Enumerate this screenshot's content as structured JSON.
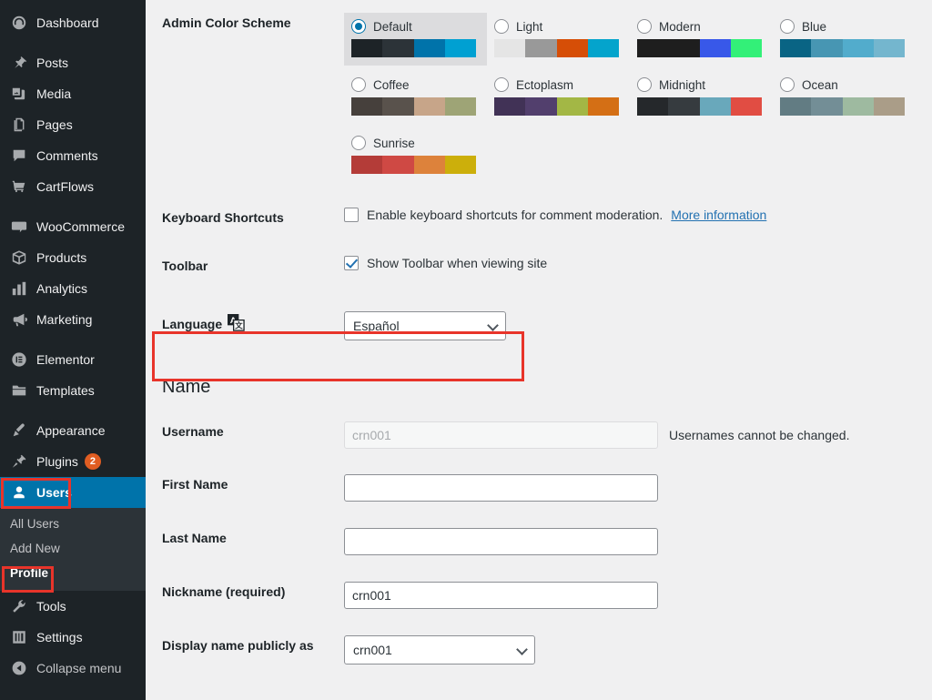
{
  "sidebar": {
    "items": [
      {
        "label": "Dashboard",
        "icon": "dashboard-icon",
        "name": "dashboard"
      },
      {
        "label": "Posts",
        "icon": "pin-icon",
        "name": "posts"
      },
      {
        "label": "Media",
        "icon": "media-icon",
        "name": "media"
      },
      {
        "label": "Pages",
        "icon": "pages-icon",
        "name": "pages"
      },
      {
        "label": "Comments",
        "icon": "comment-icon",
        "name": "comments"
      },
      {
        "label": "CartFlows",
        "icon": "cart-icon",
        "name": "cartflows"
      },
      {
        "label": "WooCommerce",
        "icon": "woo-icon",
        "name": "woocommerce"
      },
      {
        "label": "Products",
        "icon": "box-icon",
        "name": "products"
      },
      {
        "label": "Analytics",
        "icon": "chart-bar-icon",
        "name": "analytics"
      },
      {
        "label": "Marketing",
        "icon": "megaphone-icon",
        "name": "marketing"
      },
      {
        "label": "Elementor",
        "icon": "elementor-icon",
        "name": "elementor"
      },
      {
        "label": "Templates",
        "icon": "folder-icon",
        "name": "templates"
      },
      {
        "label": "Appearance",
        "icon": "brush-icon",
        "name": "appearance"
      },
      {
        "label": "Plugins",
        "icon": "plug-icon",
        "name": "plugins",
        "badge": "2"
      },
      {
        "label": "Users",
        "icon": "user-icon",
        "name": "users",
        "current": true
      },
      {
        "label": "Tools",
        "icon": "wrench-icon",
        "name": "tools"
      },
      {
        "label": "Settings",
        "icon": "settings-icon",
        "name": "settings"
      },
      {
        "label": "Collapse menu",
        "icon": "collapse-icon",
        "name": "collapse-menu"
      }
    ],
    "submenu": [
      {
        "label": "All Users",
        "name": "all-users"
      },
      {
        "label": "Add New",
        "name": "add-new"
      },
      {
        "label": "Profile",
        "name": "profile",
        "current": true
      }
    ],
    "colors": {
      "background": "#1d2327",
      "submenu_background": "#2c3338",
      "current_background": "#0073aa",
      "badge": "#e05d22"
    }
  },
  "main": {
    "color_scheme": {
      "label": "Admin Color Scheme",
      "selected": "Default",
      "options": [
        {
          "name": "Default",
          "selected": true,
          "swatch": [
            "#1d2327",
            "#2c3338",
            "#0073aa",
            "#00a0d2"
          ]
        },
        {
          "name": "Light",
          "selected": false,
          "swatch": [
            "#e5e5e5",
            "#999999",
            "#d64e07",
            "#04a4cc"
          ]
        },
        {
          "name": "Modern",
          "selected": false,
          "swatch": [
            "#1e1e1e",
            "#1e1e1e",
            "#3858e9",
            "#33f078"
          ]
        },
        {
          "name": "Blue",
          "selected": false,
          "swatch": [
            "#096484",
            "#4796b3",
            "#52accc",
            "#74b6ce"
          ]
        },
        {
          "name": "Coffee",
          "selected": false,
          "swatch": [
            "#46403c",
            "#59524c",
            "#c7a589",
            "#9ea476"
          ]
        },
        {
          "name": "Ectoplasm",
          "selected": false,
          "swatch": [
            "#413256",
            "#523f6d",
            "#a3b745",
            "#d46f15"
          ]
        },
        {
          "name": "Midnight",
          "selected": false,
          "swatch": [
            "#25282b",
            "#363b3f",
            "#69a8bb",
            "#e14d43"
          ]
        },
        {
          "name": "Ocean",
          "selected": false,
          "swatch": [
            "#627c83",
            "#738e96",
            "#9ebaa0",
            "#aa9d88"
          ]
        },
        {
          "name": "Sunrise",
          "selected": false,
          "swatch": [
            "#b43c38",
            "#cf4944",
            "#dd823b",
            "#ccaf0b"
          ]
        }
      ]
    },
    "keyboard_shortcuts": {
      "label": "Keyboard Shortcuts",
      "checkbox_label": "Enable keyboard shortcuts for comment moderation.",
      "link_label": "More information",
      "checked": false
    },
    "toolbar": {
      "label": "Toolbar",
      "checkbox_label": "Show Toolbar when viewing site",
      "checked": true
    },
    "language": {
      "label": "Language",
      "icon": "translate-icon",
      "value": "Español"
    },
    "name_section": {
      "title": "Name",
      "username": {
        "label": "Username",
        "value": "crn001",
        "helper": "Usernames cannot be changed."
      },
      "first_name": {
        "label": "First Name",
        "value": ""
      },
      "last_name": {
        "label": "Last Name",
        "value": ""
      },
      "nickname": {
        "label": "Nickname (required)",
        "value": "crn001"
      },
      "display_name": {
        "label": "Display name publicly as",
        "value": "crn001"
      }
    }
  },
  "annotations": {
    "highlight_color": "#e8342a",
    "boxes": [
      "users-menu-item",
      "profile-submenu-item",
      "language-row"
    ]
  }
}
